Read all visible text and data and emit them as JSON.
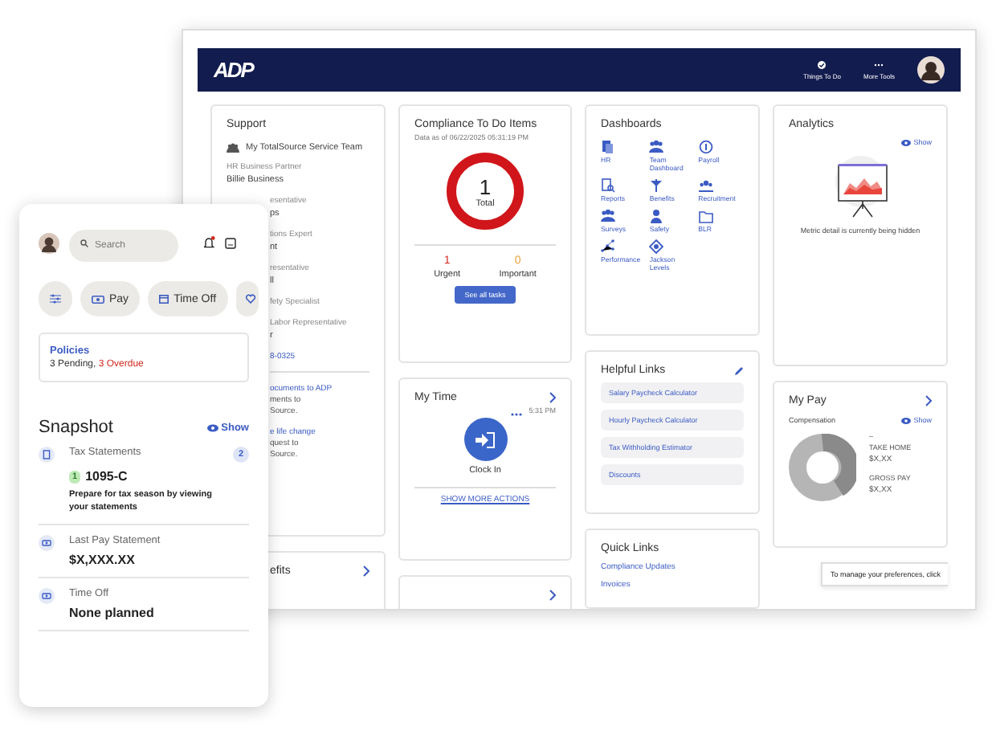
{
  "window": {
    "logo": "ADP",
    "nav": [
      {
        "label": "Things To Do"
      },
      {
        "label": "More Tools"
      }
    ]
  },
  "support": {
    "title": "Support",
    "team": "My TotalSource Service Team",
    "partner_role": "HR Business Partner",
    "partner_name": "Billie Business",
    "contacts": [
      {
        "kind": "label",
        "text": "esentative"
      },
      {
        "kind": "value",
        "text": "ps"
      },
      {
        "kind": "label",
        "text": "tions Expert"
      },
      {
        "kind": "value",
        "text": "nt"
      },
      {
        "kind": "label",
        "text": "resentative"
      },
      {
        "kind": "value",
        "text": "ll"
      },
      {
        "kind": "label",
        "text": "fety Specialist"
      },
      {
        "kind": "label",
        "text": "Labor Representative"
      },
      {
        "kind": "value",
        "text": "r"
      },
      {
        "kind": "link",
        "text": "8-0325"
      }
    ],
    "actions": [
      {
        "kind": "link",
        "text": "ocuments to ADP"
      },
      {
        "kind": "text",
        "text": "ments to"
      },
      {
        "kind": "text",
        "text": "Source."
      },
      {
        "kind": "link",
        "text": "e life change"
      },
      {
        "kind": "text",
        "text": "quest to"
      },
      {
        "kind": "text",
        "text": "Source."
      }
    ]
  },
  "benefits": {
    "title": "efits"
  },
  "compliance": {
    "title": "Compliance To Do Items",
    "date": "Data as of 06/22/2025 05:31:19 PM",
    "total": "1",
    "total_label": "Total",
    "counts": [
      {
        "value": "1",
        "label": "Urgent",
        "color": "#d0271d"
      },
      {
        "value": "0",
        "label": "Important",
        "color": "#e8a33d"
      }
    ],
    "button": "See all tasks"
  },
  "my_time": {
    "title": "My Time",
    "time": "5:31 PM",
    "action": "Clock In",
    "more": "SHOW MORE ACTIONS"
  },
  "dashboards": {
    "title": "Dashboards",
    "items": [
      {
        "label": "HR"
      },
      {
        "label": "Team Dashboard"
      },
      {
        "label": "Payroll"
      },
      {
        "label": "Reports"
      },
      {
        "label": "Benefits"
      },
      {
        "label": "Recruitment"
      },
      {
        "label": "Surveys"
      },
      {
        "label": "Safety"
      },
      {
        "label": "BLR"
      },
      {
        "label": "Performance"
      },
      {
        "label": "Jackson Levels"
      }
    ]
  },
  "helpful_links": {
    "title": "Helpful Links",
    "links": [
      "Salary Paycheck Calculator",
      "Hourly Paycheck Calculator",
      "Tax Withholding Estimator",
      "Discounts"
    ]
  },
  "quick_links": {
    "title": "Quick Links",
    "links": [
      "Compliance Updates",
      "Invoices"
    ]
  },
  "analytics": {
    "title": "Analytics",
    "show": "Show",
    "message": "Metric detail is currently being hidden"
  },
  "my_pay": {
    "title": "My Pay",
    "label": "Compensation",
    "show": "Show",
    "dash": "–",
    "items": [
      {
        "label": "TAKE HOME",
        "value": "$X,XX"
      },
      {
        "label": "GROSS PAY",
        "value": "$X,XX"
      }
    ]
  },
  "banner": "To manage your preferences, click",
  "phone": {
    "search": {
      "placeholder": "Search"
    },
    "chips": [
      {
        "label": "Pay"
      },
      {
        "label": "Time Off"
      }
    ],
    "policies": {
      "title": "Policies",
      "status": [
        {
          "kind": "normal",
          "text": "3 Pending, "
        },
        {
          "kind": "alert",
          "text": "3 Overdue"
        }
      ]
    },
    "snapshot": {
      "title": "Snapshot",
      "show": "Show",
      "items": [
        {
          "title": "Tax Statements",
          "count": "2",
          "badge": "1",
          "value": "1095-C",
          "note": "Prepare for tax season by viewing your statements"
        },
        {
          "title": "Last Pay Statement",
          "value": "$X,XXX.XX"
        },
        {
          "title": "Time Off",
          "value": "None planned"
        }
      ]
    }
  }
}
